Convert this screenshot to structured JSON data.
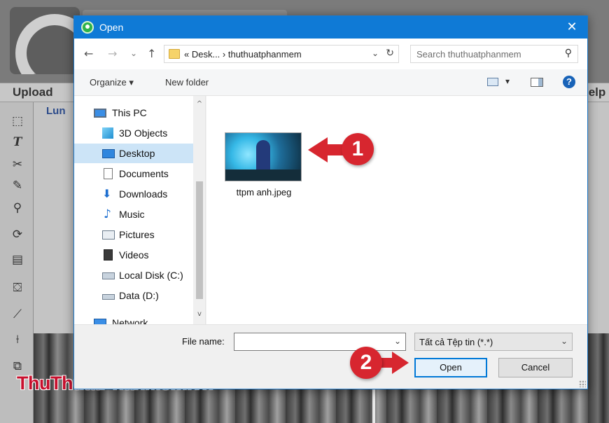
{
  "background_app": {
    "menu": {
      "upload": "Upload",
      "help_partial": "lelp"
    },
    "panel_label_partial": "Lun",
    "watermark": {
      "part1": "Thu",
      "part2": "Thuat",
      "part3": "Phan",
      "part4": "Mem",
      "part5": ".vn"
    }
  },
  "dialog": {
    "title": "Open",
    "close_glyph": "✕",
    "nav": {
      "back": "←",
      "forward": "→",
      "recent": "⌄",
      "up": "↑"
    },
    "address": {
      "text": "«  Desk...  ›  thuthuatphanmem",
      "dropdown": "⌄",
      "refresh": "↻"
    },
    "search": {
      "placeholder": "Search thuthuatphanmem",
      "icon": "⚲"
    },
    "commands": {
      "organize": "Organize ▾",
      "new_folder": "New folder",
      "view_dropdown": "▾",
      "help": "?"
    },
    "nav_pane": {
      "items": [
        {
          "label": "This PC",
          "icon": "computer-icon"
        },
        {
          "label": "3D Objects",
          "icon": "3d-objects-icon"
        },
        {
          "label": "Desktop",
          "icon": "desktop-icon",
          "selected": true
        },
        {
          "label": "Documents",
          "icon": "documents-icon"
        },
        {
          "label": "Downloads",
          "icon": "downloads-icon"
        },
        {
          "label": "Music",
          "icon": "music-icon"
        },
        {
          "label": "Pictures",
          "icon": "pictures-icon"
        },
        {
          "label": "Videos",
          "icon": "videos-icon"
        },
        {
          "label": "Local Disk (C:)",
          "icon": "local-disk-icon"
        },
        {
          "label": "Data (D:)",
          "icon": "drive-icon"
        },
        {
          "label": "Network",
          "icon": "network-icon"
        }
      ],
      "scroll_up": "^",
      "scroll_down": "v"
    },
    "files": [
      {
        "name": "ttpm anh.jpeg"
      }
    ],
    "bottom": {
      "file_name_label": "File name:",
      "file_name_value": "",
      "file_type": "Tất cả Tệp tin (*.*)",
      "dropdown": "⌄",
      "open_label": "Open",
      "cancel_label": "Cancel"
    }
  },
  "annotations": {
    "step1": "1",
    "step2": "2"
  },
  "colors": {
    "titlebar": "#0f7ad6",
    "accent_red": "#d7262f",
    "selected": "#cce4f7"
  }
}
